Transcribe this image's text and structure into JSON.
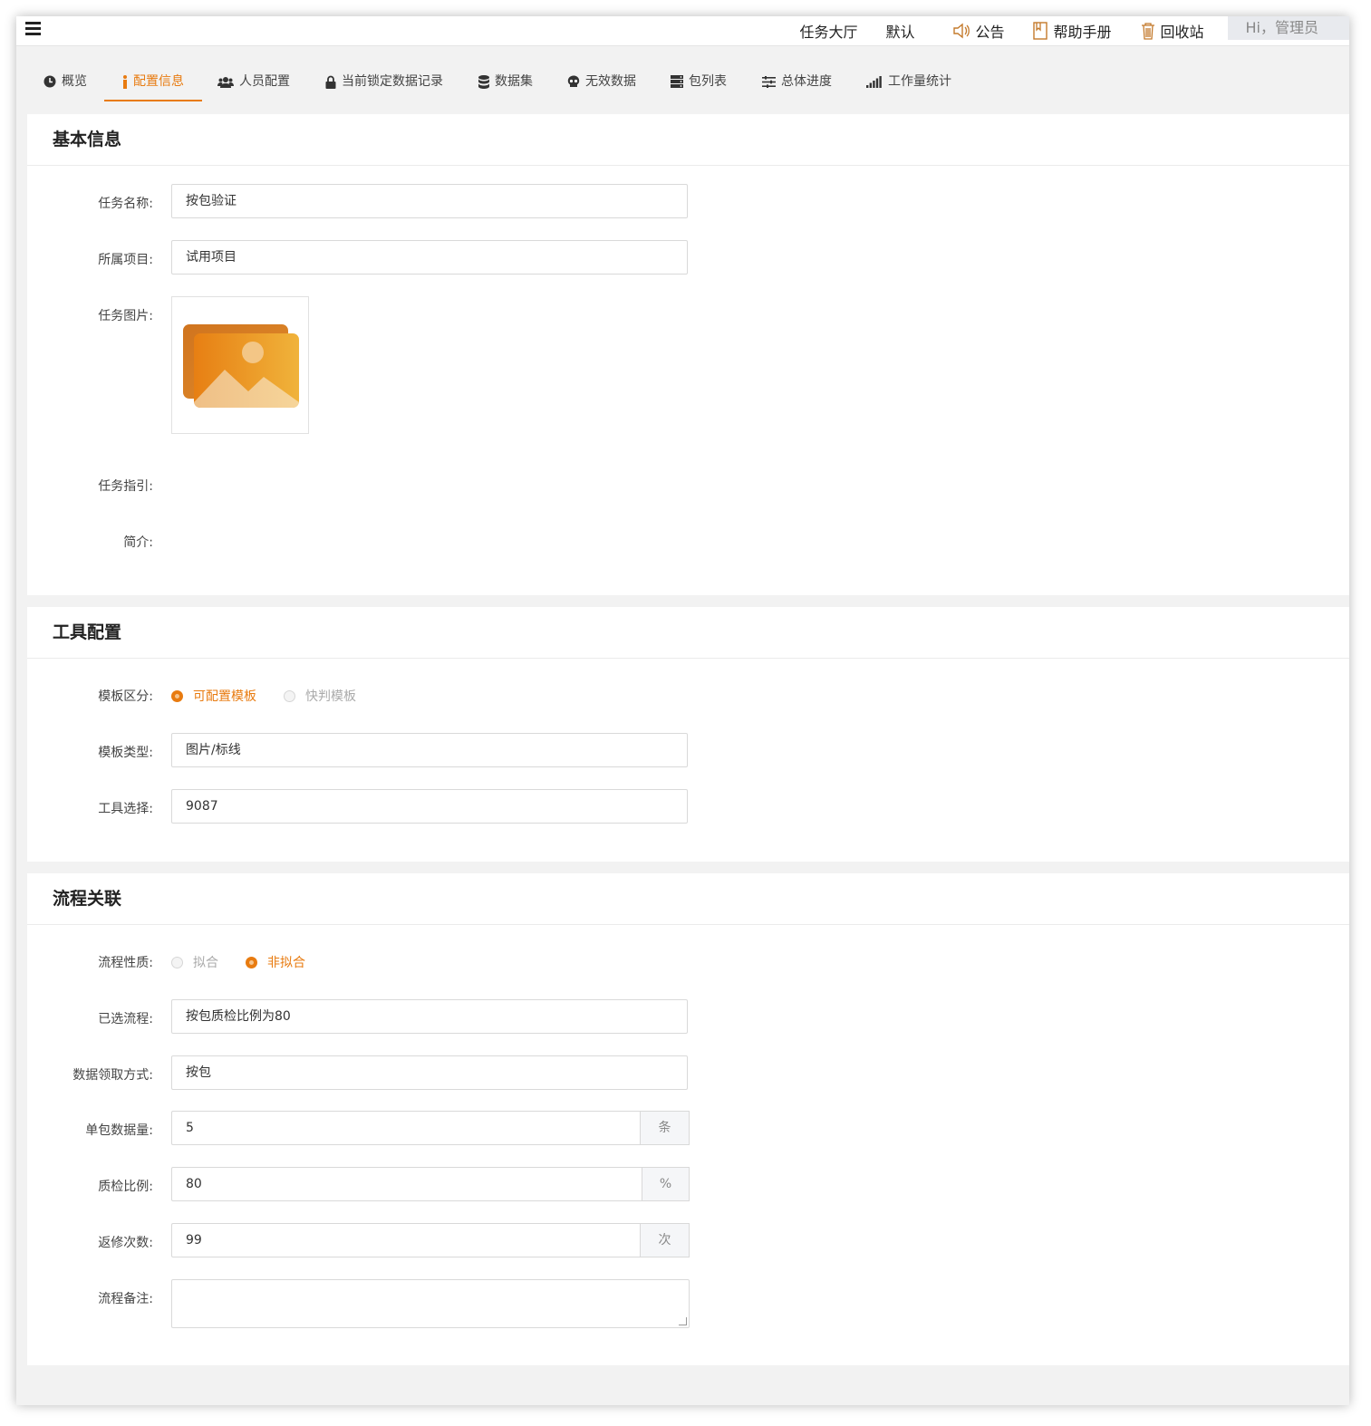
{
  "topnav": {
    "items": [
      {
        "label": "任务大厅",
        "icon": ""
      },
      {
        "label": "默认",
        "icon": ""
      },
      {
        "label": "公告",
        "icon": "speaker-icon"
      },
      {
        "label": "帮助手册",
        "icon": "bookmark-icon"
      },
      {
        "label": "回收站",
        "icon": "trash-icon"
      }
    ],
    "user": "Hi，管理员"
  },
  "tabs": [
    {
      "label": "概览",
      "icon": "clock-icon"
    },
    {
      "label": "配置信息",
      "icon": "info-icon",
      "active": true
    },
    {
      "label": "人员配置",
      "icon": "users-icon"
    },
    {
      "label": "当前锁定数据记录",
      "icon": "lock-icon"
    },
    {
      "label": "数据集",
      "icon": "database-icon"
    },
    {
      "label": "无效数据",
      "icon": "skull-icon"
    },
    {
      "label": "包列表",
      "icon": "server-icon"
    },
    {
      "label": "总体进度",
      "icon": "sliders-icon"
    },
    {
      "label": "工作量统计",
      "icon": "signal-icon"
    }
  ],
  "basic": {
    "title": "基本信息",
    "task_name_label": "任务名称:",
    "task_name": "按包验证",
    "project_label": "所属项目:",
    "project": "试用项目",
    "image_label": "任务图片:",
    "guide_label": "任务指引:",
    "intro_label": "简介:"
  },
  "tool": {
    "title": "工具配置",
    "template_kind_label": "模板区分:",
    "template_kind_options": [
      "可配置模板",
      "快判模板"
    ],
    "template_kind_selected": "可配置模板",
    "template_type_label": "模板类型:",
    "template_type": "图片/标线",
    "tool_label": "工具选择:",
    "tool": "9087"
  },
  "flow": {
    "title": "流程关联",
    "nature_label": "流程性质:",
    "nature_options": [
      "拟合",
      "非拟合"
    ],
    "nature_selected": "非拟合",
    "selected_flow_label": "已选流程:",
    "selected_flow": "按包质检比例为80",
    "fetch_mode_label": "数据领取方式:",
    "fetch_mode": "按包",
    "pack_size_label": "单包数据量:",
    "pack_size": "5",
    "pack_size_unit": "条",
    "qc_ratio_label": "质检比例:",
    "qc_ratio": "80",
    "qc_ratio_unit": "%",
    "rework_label": "返修次数:",
    "rework": "99",
    "rework_unit": "次",
    "note_label": "流程备注:",
    "note": ""
  },
  "colors": {
    "accent": "#e87b10",
    "page_bg": "#f2f2f2"
  }
}
